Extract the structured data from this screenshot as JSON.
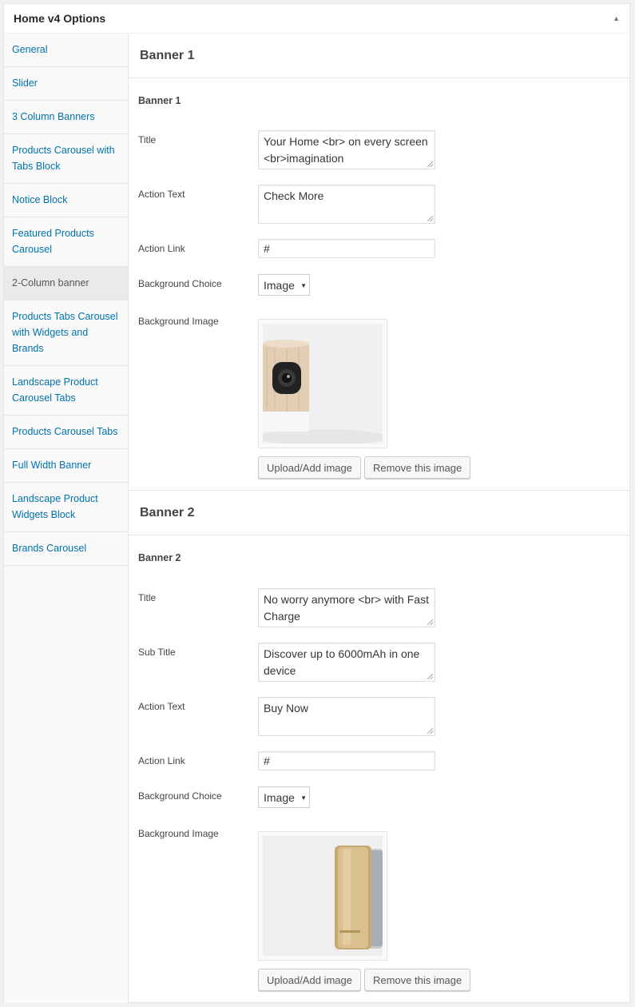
{
  "panel": {
    "title": "Home v4 Options"
  },
  "sidebar": {
    "items": [
      {
        "label": "General",
        "active": false
      },
      {
        "label": "Slider",
        "active": false
      },
      {
        "label": "3 Column Banners",
        "active": false
      },
      {
        "label": "Products Carousel with Tabs Block",
        "active": false
      },
      {
        "label": "Notice Block",
        "active": false
      },
      {
        "label": "Featured Products Carousel",
        "active": false
      },
      {
        "label": "2-Column banner",
        "active": true
      },
      {
        "label": "Products Tabs Carousel with Widgets and Brands",
        "active": false
      },
      {
        "label": "Landscape Product Carousel Tabs",
        "active": false
      },
      {
        "label": "Products Carousel Tabs",
        "active": false
      },
      {
        "label": "Full Width Banner",
        "active": false
      },
      {
        "label": "Landscape Product Widgets Block",
        "active": false
      },
      {
        "label": "Brands Carousel",
        "active": false
      }
    ]
  },
  "banner1": {
    "section_title": "Banner 1",
    "group_title": "Banner 1",
    "title_label": "Title",
    "title_value": "Your Home <br> on every screen <br>imagination",
    "action_text_label": "Action Text",
    "action_text_value": "Check More",
    "action_link_label": "Action Link",
    "action_link_value": "#",
    "bg_choice_label": "Background Choice",
    "bg_choice_value": "Image",
    "bg_image_label": "Background Image",
    "upload_label": "Upload/Add image",
    "remove_label": "Remove this image"
  },
  "banner2": {
    "section_title": "Banner 2",
    "group_title": "Banner 2",
    "title_label": "Title",
    "title_value": "No worry anymore <br> with Fast Charge",
    "subtitle_label": "Sub Title",
    "subtitle_value": "Discover up to 6000mAh in one device",
    "action_text_label": "Action Text",
    "action_text_value": "Buy Now",
    "action_link_label": "Action Link",
    "action_link_value": "#",
    "bg_choice_label": "Background Choice",
    "bg_choice_value": "Image",
    "bg_image_label": "Background Image",
    "upload_label": "Upload/Add image",
    "remove_label": "Remove this image"
  },
  "colors": {
    "link": "#0073aa",
    "active_bg": "#eaeaea",
    "border": "#e5e5e5"
  }
}
